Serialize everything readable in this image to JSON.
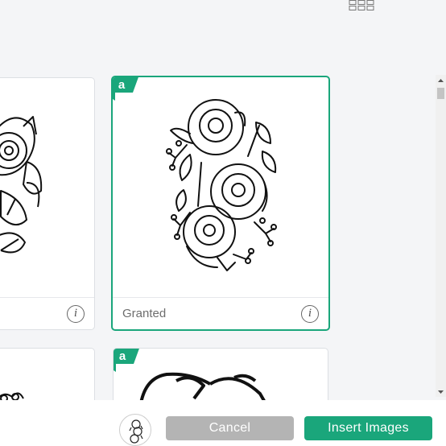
{
  "colors": {
    "accent": "#1aa67b",
    "cancel": "#b4b4b4"
  },
  "cards": [
    {
      "name": "",
      "info_icon": "info-icon"
    },
    {
      "name": "Granted",
      "badge": "a",
      "selected": true,
      "info_icon": "info-icon"
    },
    {
      "name": ""
    },
    {
      "name": "",
      "badge": "a"
    }
  ],
  "footer": {
    "cancel_label": "Cancel",
    "insert_label": "Insert Images"
  }
}
